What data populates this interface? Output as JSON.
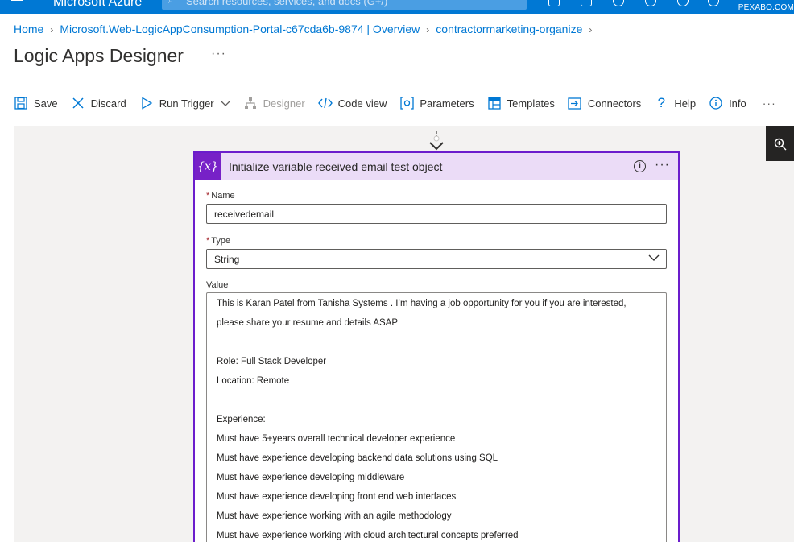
{
  "topbar": {
    "brand": "Microsoft Azure",
    "search_placeholder": "Search resources, services, and docs (G+/)",
    "directory": "PEXABO.COM"
  },
  "breadcrumb": [
    {
      "label": "Home"
    },
    {
      "label": "Microsoft.Web-LogicAppConsumption-Portal-c67cda6b-9874 | Overview"
    },
    {
      "label": "contractormarketing-organize"
    }
  ],
  "page": {
    "title": "Logic Apps Designer",
    "more": "···"
  },
  "toolbar": {
    "save": "Save",
    "discard": "Discard",
    "run_trigger": "Run Trigger",
    "designer": "Designer",
    "code_view": "Code view",
    "parameters": "Parameters",
    "templates": "Templates",
    "connectors": "Connectors",
    "help": "Help",
    "info": "Info",
    "more": "···"
  },
  "card": {
    "icon_text": "{x}",
    "title": "Initialize variable received email test object",
    "name_label": "Name",
    "name_value": "receivedemail",
    "type_label": "Type",
    "type_value": "String",
    "value_label": "Value",
    "value_lines": [
      "This is Karan Patel from Tanisha Systems . I’m having a job opportunity for you if you are interested,",
      "please share your resume and details ASAP",
      "",
      "Role: Full Stack Developer",
      "Location: Remote",
      "",
      "Experience:",
      "Must have 5+years overall technical developer experience",
      "Must have experience developing backend data solutions using SQL",
      "Must have experience developing middleware",
      "Must have experience developing front end web interfaces",
      "Must have experience working with an agile methodology",
      "Must have experience working with cloud architectural concepts preferred"
    ]
  },
  "colors": {
    "azure_blue": "#0078d4",
    "card_border": "#6b1dcc",
    "card_header": "#ebdcf7",
    "variable_icon": "#7721c7",
    "canvas_bg": "#f3f2f1"
  }
}
